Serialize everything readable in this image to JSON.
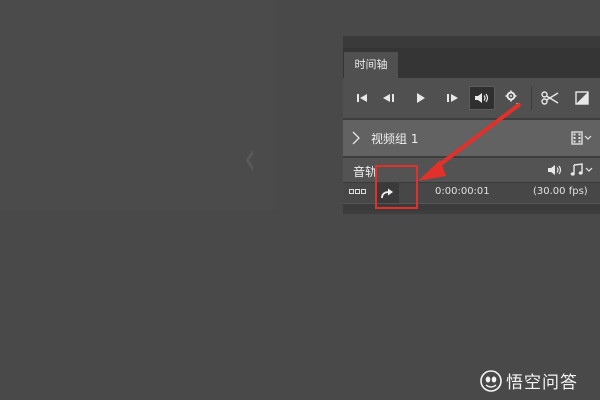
{
  "panel": {
    "tab_label": "时间轴",
    "group_label": "视频组 1",
    "audio_label": "音轨",
    "timecode": "0:00:00:01",
    "fps": "(30.00 fps)"
  },
  "toolbar": {
    "icons": [
      "first-frame-icon",
      "prev-frame-icon",
      "play-icon",
      "next-frame-icon",
      "audio-mute-icon",
      "settings-gear-icon",
      "split-scissors-icon",
      "transition-icon"
    ]
  },
  "watermark": {
    "text": "悟空问答"
  },
  "colors": {
    "background": "#494949",
    "panel": "#3e3e3e",
    "toolbar": "#505050",
    "group_row": "#626262",
    "annotation_red": "#e2312b"
  }
}
